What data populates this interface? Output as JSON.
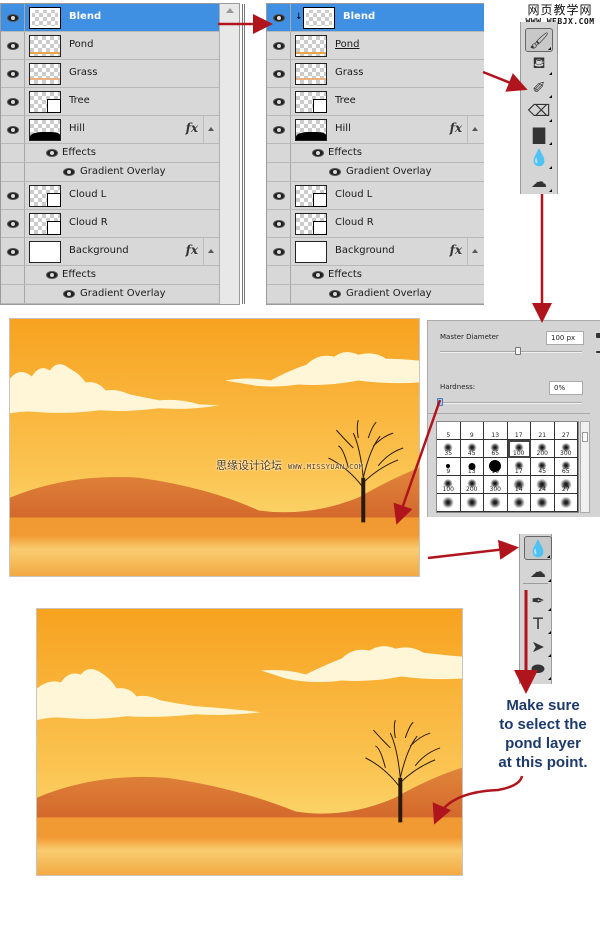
{
  "layers_panel_before": {
    "layers": [
      {
        "name": "Blend",
        "selected": true,
        "thumb": "transparent",
        "has_fx": false
      },
      {
        "name": "Pond",
        "selected": false,
        "thumb": "pond",
        "has_fx": false
      },
      {
        "name": "Grass",
        "selected": false,
        "thumb": "grass",
        "has_fx": false
      },
      {
        "name": "Tree",
        "selected": false,
        "thumb": "smart-object",
        "has_fx": false
      },
      {
        "name": "Hill",
        "selected": false,
        "thumb": "hill",
        "has_fx": true,
        "effects_label": "Effects",
        "effects": [
          "Gradient Overlay"
        ]
      },
      {
        "name": "Cloud L",
        "selected": false,
        "thumb": "smart-object",
        "has_fx": false
      },
      {
        "name": "Cloud R",
        "selected": false,
        "thumb": "smart-object",
        "has_fx": false
      },
      {
        "name": "Background",
        "selected": false,
        "thumb": "white",
        "has_fx": true,
        "effects_label": "Effects",
        "effects": [
          "Gradient Overlay"
        ]
      }
    ],
    "fx_label": "fx"
  },
  "layers_panel_after": {
    "layers": [
      {
        "name": "Blend",
        "selected": true,
        "clipped": true,
        "thumb": "transparent",
        "has_fx": false
      },
      {
        "name": "Pond",
        "selected": false,
        "underlined": true,
        "thumb": "pond",
        "has_fx": false
      },
      {
        "name": "Grass",
        "selected": false,
        "thumb": "grass",
        "has_fx": false
      },
      {
        "name": "Tree",
        "selected": false,
        "thumb": "smart-object",
        "has_fx": false
      },
      {
        "name": "Hill",
        "selected": false,
        "thumb": "hill",
        "has_fx": true,
        "effects_label": "Effects",
        "effects": [
          "Gradient Overlay"
        ]
      },
      {
        "name": "Cloud L",
        "selected": false,
        "thumb": "smart-object",
        "has_fx": false
      },
      {
        "name": "Cloud R",
        "selected": false,
        "thumb": "smart-object",
        "has_fx": false
      },
      {
        "name": "Background",
        "selected": false,
        "thumb": "white",
        "has_fx": true,
        "effects_label": "Effects",
        "effects": [
          "Gradient Overlay"
        ]
      }
    ],
    "fx_label": "fx",
    "clip_icon": "↓"
  },
  "toolbar_top": {
    "watermark_cn": "网页教学网",
    "watermark_url": "WWW.WEBJX.COM",
    "tools": [
      {
        "name": "brush-tool",
        "glyph": "🖌",
        "active": true
      },
      {
        "name": "clone-stamp-tool",
        "glyph": "⛾",
        "active": false
      },
      {
        "name": "history-brush-tool",
        "glyph": "✐",
        "active": false
      },
      {
        "name": "eraser-tool",
        "glyph": "⌫",
        "active": false
      },
      {
        "name": "gradient-tool",
        "glyph": "▇",
        "active": false
      },
      {
        "name": "blur-tool",
        "glyph": "💧",
        "active": false
      },
      {
        "name": "dodge-tool",
        "glyph": "☁",
        "active": false
      }
    ]
  },
  "brush_picker": {
    "master_diameter_label": "Master Diameter",
    "master_diameter_value": "100 px",
    "master_diameter_fraction": 0.55,
    "hardness_label": "Hardness:",
    "hardness_value": "0%",
    "hardness_fraction": 0.0,
    "presets": [
      {
        "size": "5",
        "type": "label-only"
      },
      {
        "size": "9",
        "type": "label-only"
      },
      {
        "size": "13",
        "type": "label-only"
      },
      {
        "size": "17",
        "type": "label-only"
      },
      {
        "size": "21",
        "type": "label-only"
      },
      {
        "size": "27",
        "type": "label-only"
      },
      {
        "size": "35",
        "type": "soft"
      },
      {
        "size": "45",
        "type": "soft"
      },
      {
        "size": "65",
        "type": "soft"
      },
      {
        "size": "100",
        "type": "soft",
        "selected": true
      },
      {
        "size": "200",
        "type": "soft"
      },
      {
        "size": "300",
        "type": "soft"
      },
      {
        "size": "9",
        "type": "hard"
      },
      {
        "size": "13",
        "type": "hard"
      },
      {
        "size": "19",
        "type": "hard"
      },
      {
        "size": "17",
        "type": "soft"
      },
      {
        "size": "45",
        "type": "soft"
      },
      {
        "size": "65",
        "type": "soft"
      },
      {
        "size": "100",
        "type": "soft"
      },
      {
        "size": "200",
        "type": "soft"
      },
      {
        "size": "300",
        "type": "soft"
      },
      {
        "size": "14",
        "type": "splat"
      },
      {
        "size": "24",
        "type": "splat"
      },
      {
        "size": "27",
        "type": "splat"
      },
      {
        "size": "",
        "type": "splat"
      },
      {
        "size": "",
        "type": "splat"
      },
      {
        "size": "",
        "type": "splat"
      },
      {
        "size": "",
        "type": "splat"
      },
      {
        "size": "",
        "type": "splat"
      },
      {
        "size": "",
        "type": "splat"
      }
    ]
  },
  "scene_before": {
    "watermark_cn": "思缘设计论坛",
    "watermark_url": "WWW.MISSYUAN.COM"
  },
  "toolbar_bottom": {
    "tools": [
      {
        "name": "blur-tool",
        "glyph": "💧",
        "active": true
      },
      {
        "name": "dodge-tool",
        "glyph": "☁",
        "active": false
      },
      {
        "name": "pen-tool",
        "glyph": "✒",
        "active": false
      },
      {
        "name": "type-tool",
        "glyph": "T",
        "active": false
      },
      {
        "name": "path-selection-tool",
        "glyph": "➤",
        "active": false
      },
      {
        "name": "ellipse-shape-tool",
        "glyph": "⬬",
        "active": false
      }
    ]
  },
  "callout": {
    "lines": [
      "Make sure",
      "to select the",
      "pond layer",
      "at this point."
    ]
  },
  "colors": {
    "selection_blue": "#3f90e2",
    "arrow_red": "#b0141c",
    "callout_navy": "#1d3a6b",
    "sky_top": "#f7a21f",
    "sky_bottom": "#fbd56a",
    "hill": "#d9722c",
    "grass": "#f19a34",
    "pond": "#f8cd70"
  }
}
